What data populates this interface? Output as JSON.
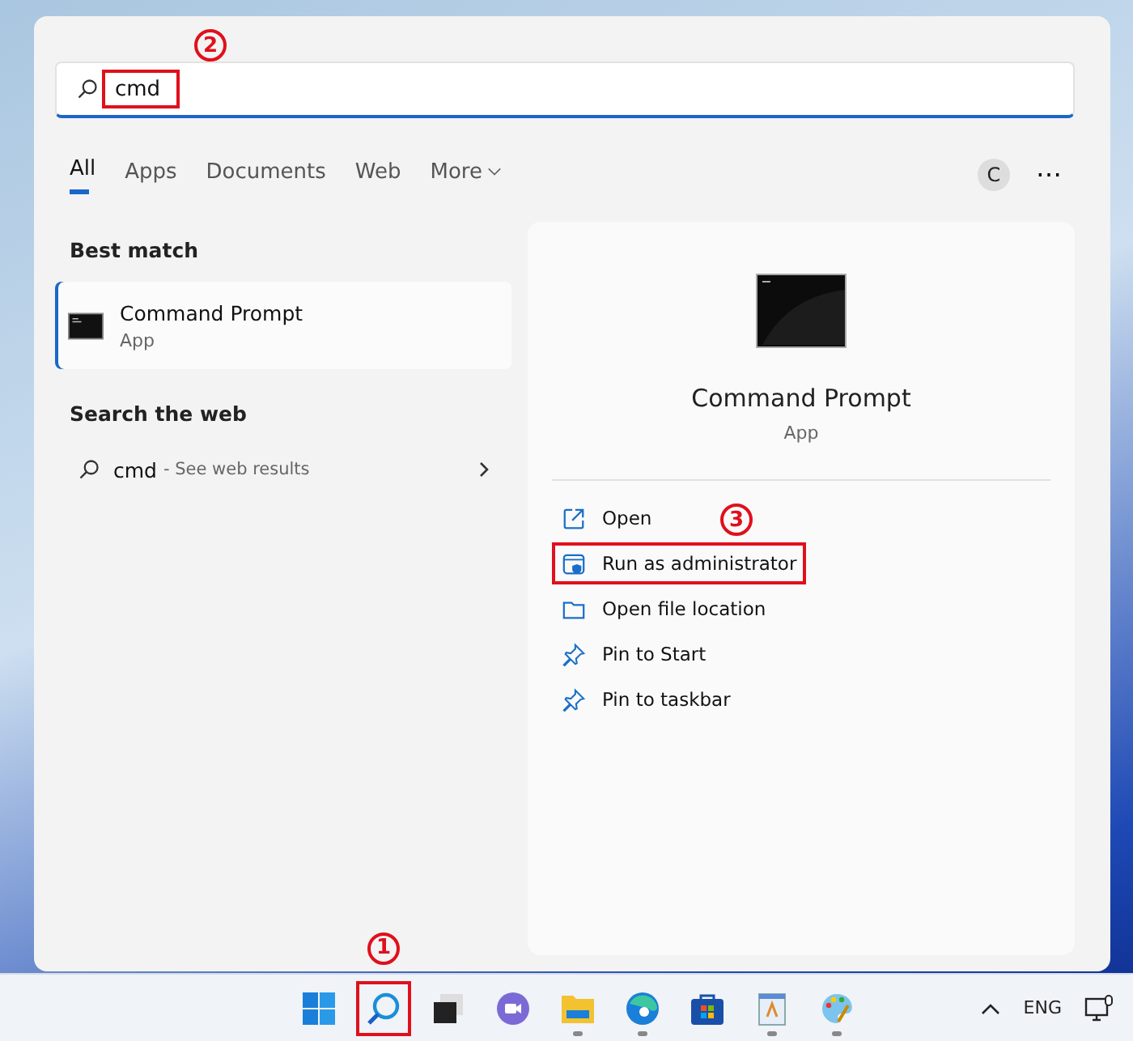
{
  "search": {
    "value": "cmd",
    "highlighted": true,
    "callout": "2"
  },
  "tabs": [
    {
      "label": "All",
      "selected": true
    },
    {
      "label": "Apps",
      "selected": false
    },
    {
      "label": "Documents",
      "selected": false
    },
    {
      "label": "Web",
      "selected": false
    },
    {
      "label": "More",
      "selected": false,
      "dropdown": true
    }
  ],
  "account": {
    "initial": "C"
  },
  "more_options": "⋯",
  "best_match": {
    "heading": "Best match",
    "result": {
      "title": "Command Prompt",
      "subtitle": "App",
      "selected": true
    }
  },
  "web_search": {
    "heading": "Search the web",
    "query": "cmd",
    "hint": "- See web results"
  },
  "preview": {
    "title": "Command Prompt",
    "subtitle": "App",
    "actions": [
      {
        "kind": "open",
        "label": "Open",
        "highlighted": false
      },
      {
        "kind": "admin",
        "label": "Run as administrator",
        "highlighted": true,
        "callout": "3"
      },
      {
        "kind": "folder",
        "label": "Open file location",
        "highlighted": false
      },
      {
        "kind": "pin",
        "label": "Pin to Start",
        "highlighted": false
      },
      {
        "kind": "pin",
        "label": "Pin to taskbar",
        "highlighted": false
      }
    ]
  },
  "taskbar": {
    "apps": [
      {
        "kind": "start",
        "running": false,
        "highlighted": false
      },
      {
        "kind": "search",
        "running": false,
        "highlighted": true,
        "callout": "1"
      },
      {
        "kind": "taskview",
        "running": false,
        "highlighted": false
      },
      {
        "kind": "chat",
        "running": false,
        "highlighted": false
      },
      {
        "kind": "explorer",
        "running": true,
        "highlighted": false
      },
      {
        "kind": "edge",
        "running": true,
        "highlighted": false
      },
      {
        "kind": "store",
        "running": false,
        "highlighted": false
      },
      {
        "kind": "notepad",
        "running": true,
        "highlighted": false
      },
      {
        "kind": "paint",
        "running": true,
        "highlighted": false
      }
    ],
    "language": "ENG"
  }
}
